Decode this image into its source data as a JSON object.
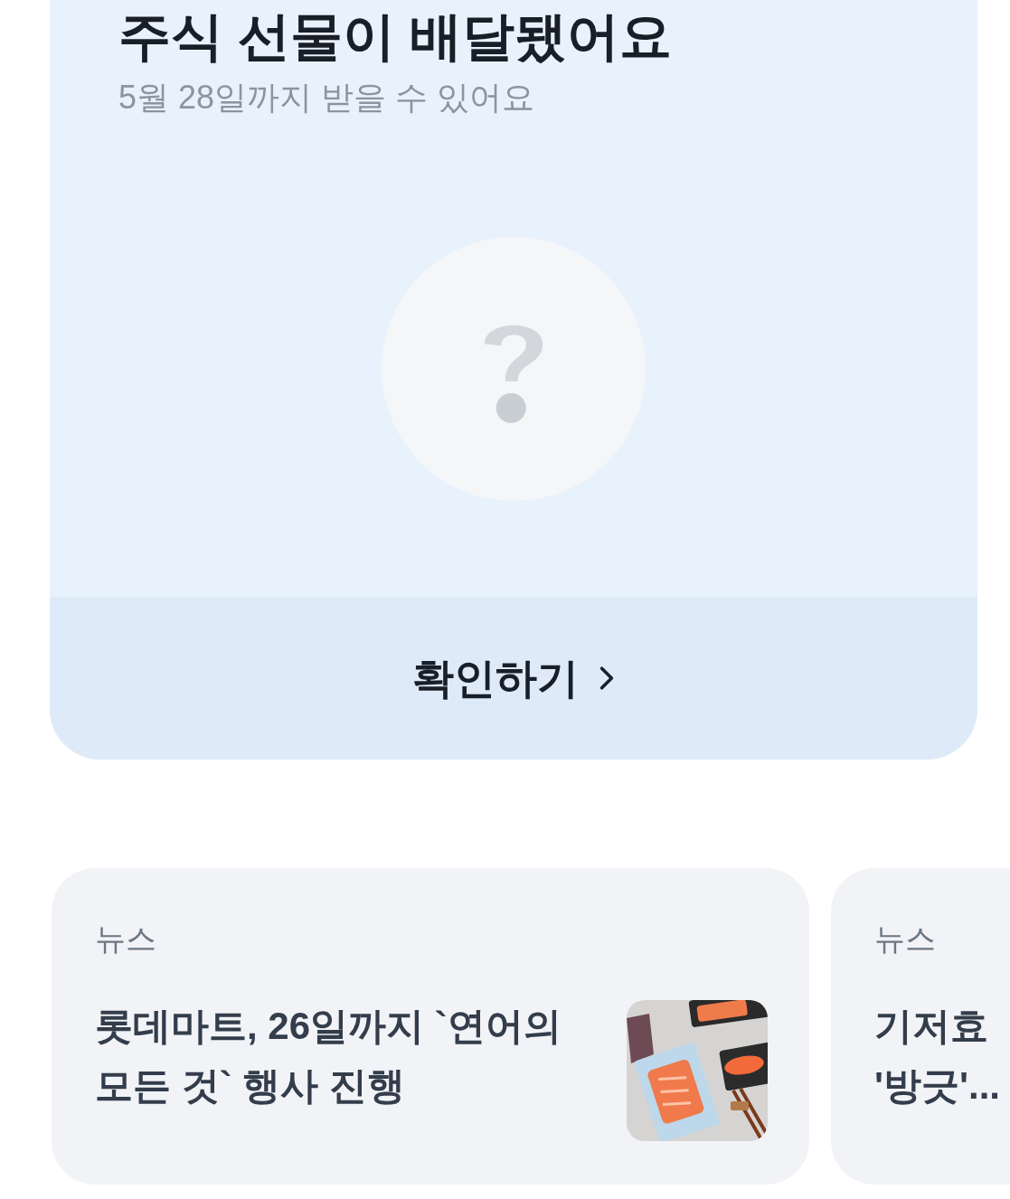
{
  "gift_card": {
    "title": "주식 선물이 배달됐어요",
    "subtitle": "5월 28일까지 받을 수 있어요",
    "confirm_button": {
      "label": "확인하기"
    }
  },
  "news_cards": [
    {
      "category": "뉴스",
      "headline": "롯데마트, 26일까지 `연어의 모든 것` 행사 진행"
    },
    {
      "category": "뉴스",
      "headline_lines": [
        "기저효",
        "'방긋'..."
      ]
    }
  ]
}
